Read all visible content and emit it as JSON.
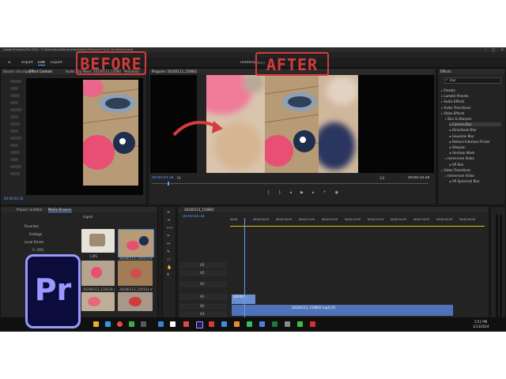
{
  "window": {
    "title": "Adobe Premiere Pro 2024 - C:\\Users\\Asus\\Documents\\Adobe\\Premiere Pro\\24.0\\Untitled.prproj",
    "menu": [
      "File",
      "Edit",
      "Clip",
      "Sequence",
      "Markers",
      "Graphics",
      "View",
      "Window",
      "Help"
    ]
  },
  "workspace": {
    "tabs": [
      "Import",
      "Edit",
      "Export"
    ],
    "project_title": "Untitled",
    "edited_label": "Edited"
  },
  "annotations": {
    "before_label": "BEFORE",
    "after_label": "AFTER",
    "arrow_color": "#d63b3b",
    "label_color": "#d63b3b"
  },
  "source_panel": {
    "tabs": [
      "Source: (no clips)",
      "Effect Controls",
      "Audio Clip Mixer: 20240113_150802",
      "Metadata"
    ],
    "timecode": "00:00:04:18"
  },
  "program_panel": {
    "title": "Program: 20240113_150802",
    "timecode": "00:00:04:18",
    "fit": "Fit",
    "quality": "1/2",
    "duration": "00:00:10:26"
  },
  "project_panel": {
    "tabs": [
      "Project: Untitled",
      "Media Browser"
    ],
    "ingest_label": "Ingest",
    "favorites_label": "Favorites",
    "local_drives_label": "Local Drives",
    "tree_items": [
      "Footage",
      "C: (OS)",
      "D:"
    ],
    "files": [
      {
        "name": "1.JPG"
      },
      {
        "name": "20240113_150113.mp4"
      },
      {
        "name": "20240113_110124.mp4"
      },
      {
        "name": "20240113_150151.mp4"
      },
      {
        "name": ""
      },
      {
        "name": ""
      }
    ]
  },
  "timeline": {
    "sequence_name": "20240113_150802",
    "timecode": "00:00:04:18",
    "ruler": [
      "00:00",
      "00:00:04:29",
      "00:00:09:29",
      "00:00:14:29",
      "00:00:19:29",
      "00:00:24:29",
      "00:00:29:29",
      "00:00:34:29",
      "00:00:39:29",
      "00:00:44:29",
      "00:00:49:29"
    ],
    "tracks": [
      "V3",
      "V2",
      "V1",
      "A1",
      "A2",
      "A3",
      "Mix"
    ],
    "clip_v1_label": "20240113_150802.mp4 [V]",
    "clip_v2_label": "202401..."
  },
  "effects_panel": {
    "title": "Effects",
    "search_value": "blur",
    "items": [
      {
        "label": "Presets",
        "level": 0
      },
      {
        "label": "Lumetri Presets",
        "level": 0
      },
      {
        "label": "Audio Effects",
        "level": 0
      },
      {
        "label": "Audio Transitions",
        "level": 0
      },
      {
        "label": "Video Effects",
        "level": 0
      },
      {
        "label": "Blur & Sharpen",
        "level": 1
      },
      {
        "label": "Camera Blur",
        "level": 2
      },
      {
        "label": "Directional Blur",
        "level": 2
      },
      {
        "label": "Gaussian Blur",
        "level": 2
      },
      {
        "label": "Reduce Interlace Flicker",
        "level": 2
      },
      {
        "label": "Sharpen",
        "level": 2
      },
      {
        "label": "Unsharp Mask",
        "level": 2
      },
      {
        "label": "Immersive Video",
        "level": 1
      },
      {
        "label": "VR Blur",
        "level": 2
      },
      {
        "label": "Video Transitions",
        "level": 0
      },
      {
        "label": "Immersive Video",
        "level": 1
      },
      {
        "label": "VR Spherical Blur",
        "level": 2
      }
    ]
  },
  "taskbar": {
    "time": "3:51 PM",
    "date": "1/13/2024"
  },
  "logo": {
    "text": "Pr",
    "bg_color": "#0b0b3c",
    "accent_color": "#9999ff"
  }
}
